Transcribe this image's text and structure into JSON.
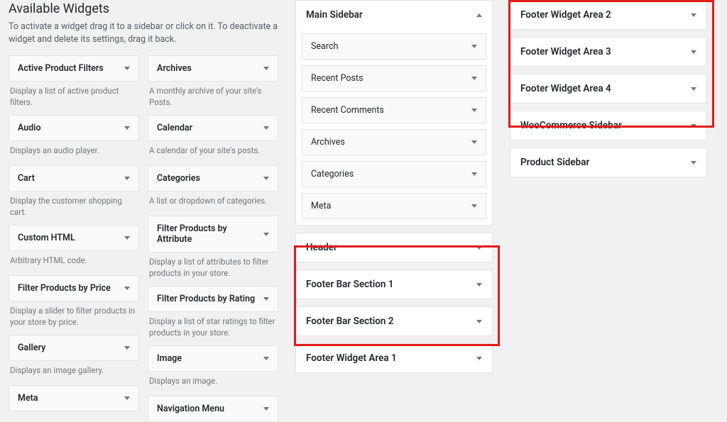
{
  "available": {
    "title": "Available Widgets",
    "desc": "To activate a widget drag it to a sidebar or click on it. To deactivate a widget and delete its settings, drag it back.",
    "left": [
      {
        "title": "Active Product Filters",
        "desc": "Display a list of active product filters."
      },
      {
        "title": "Audio",
        "desc": "Displays an audio player."
      },
      {
        "title": "Cart",
        "desc": "Display the customer shopping cart."
      },
      {
        "title": "Custom HTML",
        "desc": "Arbitrary HTML code."
      },
      {
        "title": "Filter Products by Price",
        "desc": "Display a slider to filter products in your store by price."
      },
      {
        "title": "Gallery",
        "desc": "Displays an image gallery."
      },
      {
        "title": "Meta",
        "desc": ""
      }
    ],
    "right": [
      {
        "title": "Archives",
        "desc": "A monthly archive of your site's Posts."
      },
      {
        "title": "Calendar",
        "desc": "A calendar of your site's posts."
      },
      {
        "title": "Categories",
        "desc": "A list or dropdown of categories."
      },
      {
        "title": "Filter Products by Attribute",
        "desc": "Display a list of attributes to filter products in your store."
      },
      {
        "title": "Filter Products by Rating",
        "desc": "Display a list of star ratings to filter products in your store."
      },
      {
        "title": "Image",
        "desc": "Displays an image."
      },
      {
        "title": "Navigation Menu",
        "desc": ""
      }
    ]
  },
  "mid": {
    "main_sidebar": {
      "title": "Main Sidebar",
      "widgets": [
        "Search",
        "Recent Posts",
        "Recent Comments",
        "Archives",
        "Categories",
        "Meta"
      ]
    },
    "header": {
      "title": "Header"
    },
    "footer_bar_1": {
      "title": "Footer Bar Section 1"
    },
    "footer_bar_2": {
      "title": "Footer Bar Section 2"
    },
    "footer_w1": {
      "title": "Footer Widget Area 1"
    }
  },
  "right": {
    "footer_w2": {
      "title": "Footer Widget Area 2"
    },
    "footer_w3": {
      "title": "Footer Widget Area 3"
    },
    "footer_w4": {
      "title": "Footer Widget Area 4"
    },
    "woo": {
      "title": "WooCommerce Sidebar"
    },
    "product": {
      "title": "Product Sidebar"
    }
  }
}
